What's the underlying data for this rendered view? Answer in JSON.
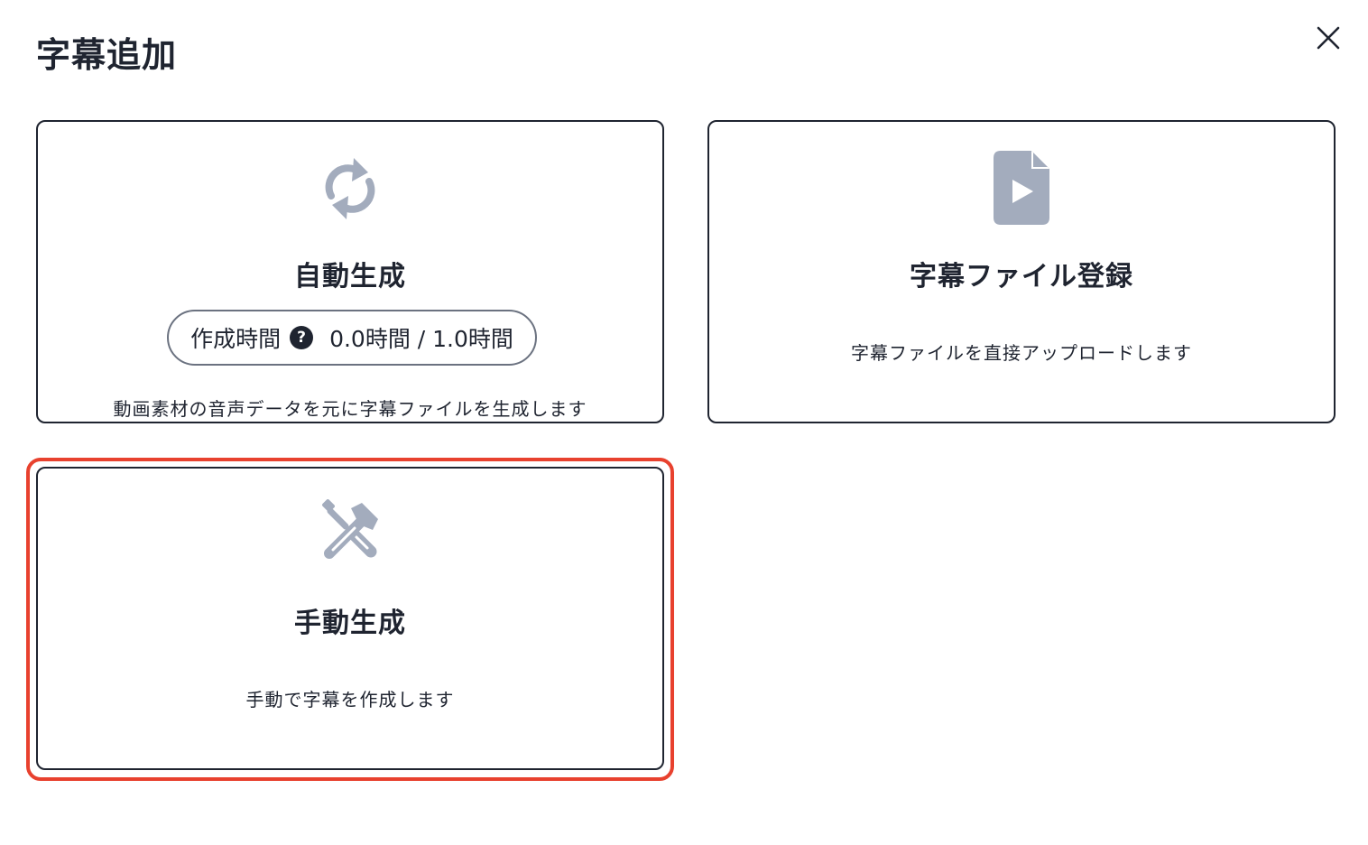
{
  "dialog": {
    "title": "字幕追加"
  },
  "icons": {
    "close": "close-icon",
    "auto": "refresh-icon",
    "file": "file-video-icon",
    "manual": "tools-icon",
    "help": "question-circle-icon"
  },
  "colors": {
    "icon_gray": "#a3acbd",
    "border": "#1f2430",
    "highlight": "#e8412e"
  },
  "cards": {
    "auto": {
      "title": "自動生成",
      "time_label": "作成時間",
      "time_value": "0.0時間 / 1.0時間",
      "help_glyph": "?",
      "description": "動画素材の音声データを元に字幕ファイルを生成します"
    },
    "file": {
      "title": "字幕ファイル登録",
      "description": "字幕ファイルを直接アップロードします"
    },
    "manual": {
      "title": "手動生成",
      "description": "手動で字幕を作成します"
    }
  }
}
